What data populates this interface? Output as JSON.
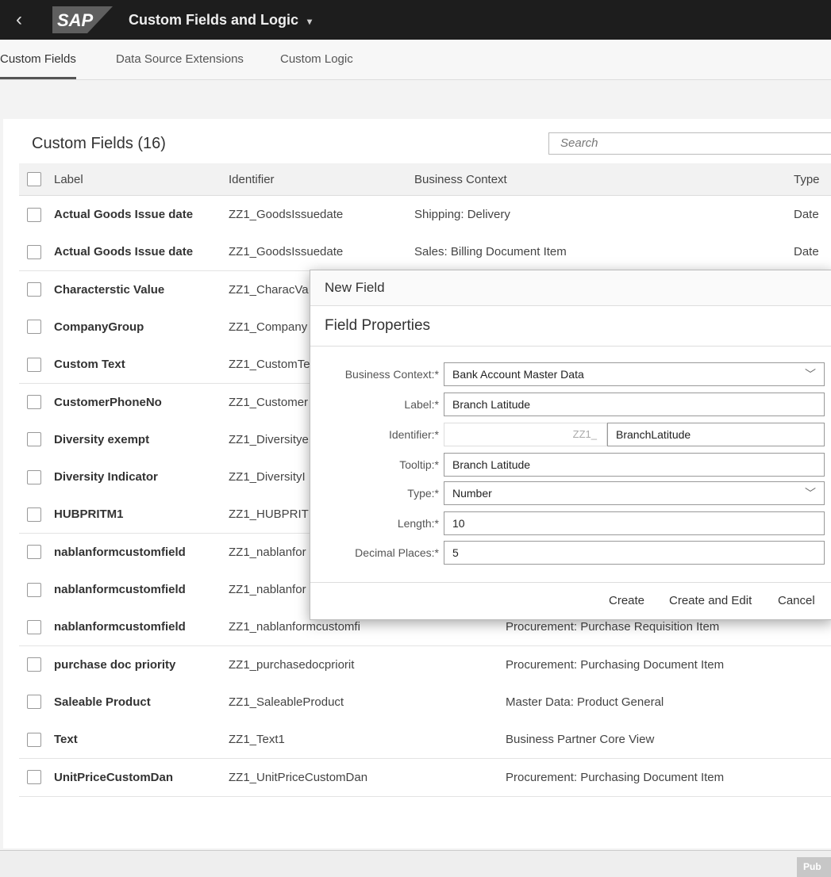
{
  "shell": {
    "logo_text": "SAP",
    "title": "Custom Fields and Logic",
    "title_caret": "▾"
  },
  "tabs": [
    {
      "label": "Custom Fields",
      "active": true
    },
    {
      "label": "Data Source Extensions"
    },
    {
      "label": "Custom Logic"
    }
  ],
  "table": {
    "title": "Custom Fields (16)",
    "search_placeholder": "Search",
    "headers": {
      "label": "Label",
      "identifier": "Identifier",
      "context": "Business Context",
      "type": "Type"
    },
    "rows": [
      {
        "label": "Actual Goods Issue date",
        "identifier": "ZZ1_GoodsIssuedate",
        "context": "Shipping: Delivery",
        "type": "Date"
      },
      {
        "label": "Actual Goods Issue date",
        "identifier": "ZZ1_GoodsIssuedate",
        "context": "Sales: Billing Document Item",
        "type": "Date"
      },
      {
        "label": "Characterstic Value",
        "identifier": "ZZ1_CharacVa",
        "context": "",
        "type": ""
      },
      {
        "label": "CompanyGroup",
        "identifier": "ZZ1_Company",
        "context": "",
        "type": ""
      },
      {
        "label": "Custom Text",
        "identifier": "ZZ1_CustomTe",
        "context": "",
        "type": ""
      },
      {
        "label": "CustomerPhoneNo",
        "identifier": "ZZ1_Customer",
        "context": "",
        "type": ""
      },
      {
        "label": "Diversity exempt",
        "identifier": "ZZ1_Diversitye",
        "context": "",
        "type": ""
      },
      {
        "label": "Diversity Indicator",
        "identifier": "ZZ1_DiversityI",
        "context": "",
        "type": ""
      },
      {
        "label": "HUBPRITM1",
        "identifier": "ZZ1_HUBPRIT",
        "context": "",
        "type": ""
      },
      {
        "label": "nablanformcustomfield",
        "identifier": "ZZ1_nablanfor",
        "context": "",
        "type": ""
      },
      {
        "label": "nablanformcustomfield",
        "identifier": "ZZ1_nablanfor",
        "context": "",
        "type": ""
      },
      {
        "label": "nablanformcustomfield",
        "identifier": "ZZ1_nablanformcustomfi",
        "context": "Procurement: Purchase Requisition Item",
        "type": ""
      },
      {
        "label": "purchase doc priority",
        "identifier": "ZZ1_purchasedocpriorit",
        "context": "Procurement: Purchasing Document Item",
        "type": ""
      },
      {
        "label": "Saleable Product",
        "identifier": "ZZ1_SaleableProduct",
        "context": "Master Data: Product General",
        "type": ""
      },
      {
        "label": "Text",
        "identifier": "ZZ1_Text1",
        "context": "Business Partner Core View",
        "type": ""
      },
      {
        "label": "UnitPriceCustomDan",
        "identifier": "ZZ1_UnitPriceCustomDan",
        "context": "Procurement: Purchasing Document Item",
        "type": ""
      }
    ]
  },
  "footer": {
    "publish_label": "Pub"
  },
  "dialog": {
    "title": "New Field",
    "section": "Field Properties",
    "fields": {
      "business_context": {
        "label": "Business Context:*",
        "value": "Bank Account Master Data"
      },
      "label": {
        "label": "Label:*",
        "value": "Branch Latitude"
      },
      "identifier": {
        "label": "Identifier:*",
        "prefix": "ZZ1_",
        "value": "BranchLatitude"
      },
      "tooltip": {
        "label": "Tooltip:*",
        "value": "Branch Latitude"
      },
      "type": {
        "label": "Type:*",
        "value": "Number"
      },
      "length": {
        "label": "Length:*",
        "value": "10"
      },
      "decimal_places": {
        "label": "Decimal Places:*",
        "value": "5"
      }
    },
    "buttons": {
      "create": "Create",
      "create_edit": "Create and Edit",
      "cancel": "Cancel"
    }
  }
}
